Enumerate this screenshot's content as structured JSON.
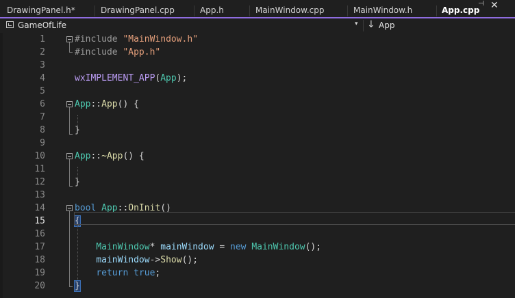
{
  "tabs": [
    {
      "label": "DrawingPanel.h*"
    },
    {
      "label": "DrawingPanel.cpp"
    },
    {
      "label": "App.h"
    },
    {
      "label": "MainWindow.cpp"
    },
    {
      "label": "MainWindow.h"
    },
    {
      "label": "App.cpp"
    }
  ],
  "active_tab": {
    "pin_glyph": "⊣",
    "close_glyph": "✕"
  },
  "navbar": {
    "project": "GameOfLife",
    "dropdown_glyph": "▾",
    "member_icon_glyph": "↓",
    "member": "App"
  },
  "colors": {
    "accent_tab_underline": "#8f6ce0",
    "background": "#1f1f1f",
    "keyword": "#569cd6",
    "type": "#4ec9b0",
    "function": "#dcdcaa",
    "string": "#e6a07c",
    "variable": "#9cdcfe",
    "macro": "#bd9ef7"
  },
  "editor": {
    "current_line": 15,
    "lines": [
      {
        "num": "1",
        "tokens": [
          [
            "pp",
            "#include "
          ],
          [
            "str",
            "\"MainWindow.h\""
          ]
        ]
      },
      {
        "num": "2",
        "tokens": [
          [
            "pp",
            "#include "
          ],
          [
            "str",
            "\"App.h\""
          ]
        ]
      },
      {
        "num": "3",
        "tokens": []
      },
      {
        "num": "4",
        "tokens": [
          [
            "macro",
            "wxIMPLEMENT_APP"
          ],
          [
            "punc",
            "("
          ],
          [
            "cls",
            "App"
          ],
          [
            "punc",
            ");"
          ]
        ]
      },
      {
        "num": "5",
        "tokens": []
      },
      {
        "num": "6",
        "tokens": [
          [
            "cls",
            "App"
          ],
          [
            "punc",
            "::"
          ],
          [
            "fn",
            "App"
          ],
          [
            "punc",
            "() {"
          ]
        ]
      },
      {
        "num": "7",
        "tokens": []
      },
      {
        "num": "8",
        "tokens": [
          [
            "punc",
            "}"
          ]
        ]
      },
      {
        "num": "9",
        "tokens": []
      },
      {
        "num": "10",
        "tokens": [
          [
            "cls",
            "App"
          ],
          [
            "punc",
            "::"
          ],
          [
            "fn",
            "~App"
          ],
          [
            "punc",
            "() {"
          ]
        ]
      },
      {
        "num": "11",
        "tokens": []
      },
      {
        "num": "12",
        "tokens": [
          [
            "punc",
            "}"
          ]
        ]
      },
      {
        "num": "13",
        "tokens": []
      },
      {
        "num": "14",
        "tokens": [
          [
            "kw",
            "bool "
          ],
          [
            "cls",
            "App"
          ],
          [
            "punc",
            "::"
          ],
          [
            "fn",
            "OnInit"
          ],
          [
            "punc",
            "()"
          ]
        ]
      },
      {
        "num": "15",
        "tokens": [
          [
            "brace",
            "{"
          ]
        ]
      },
      {
        "num": "16",
        "tokens": []
      },
      {
        "num": "17",
        "tokens": [
          [
            "punc",
            "    "
          ],
          [
            "cls",
            "MainWindow"
          ],
          [
            "punc",
            "* "
          ],
          [
            "var",
            "mainWindow"
          ],
          [
            "punc",
            " = "
          ],
          [
            "kw",
            "new "
          ],
          [
            "cls",
            "MainWindow"
          ],
          [
            "punc",
            "();"
          ]
        ]
      },
      {
        "num": "18",
        "tokens": [
          [
            "punc",
            "    "
          ],
          [
            "var",
            "mainWindow"
          ],
          [
            "punc",
            "->"
          ],
          [
            "fn",
            "Show"
          ],
          [
            "punc",
            "();"
          ]
        ]
      },
      {
        "num": "19",
        "tokens": [
          [
            "punc",
            "    "
          ],
          [
            "kw",
            "return "
          ],
          [
            "kw",
            "true"
          ],
          [
            "punc",
            ";"
          ]
        ]
      },
      {
        "num": "20",
        "tokens": [
          [
            "brace",
            "}"
          ]
        ]
      }
    ]
  }
}
